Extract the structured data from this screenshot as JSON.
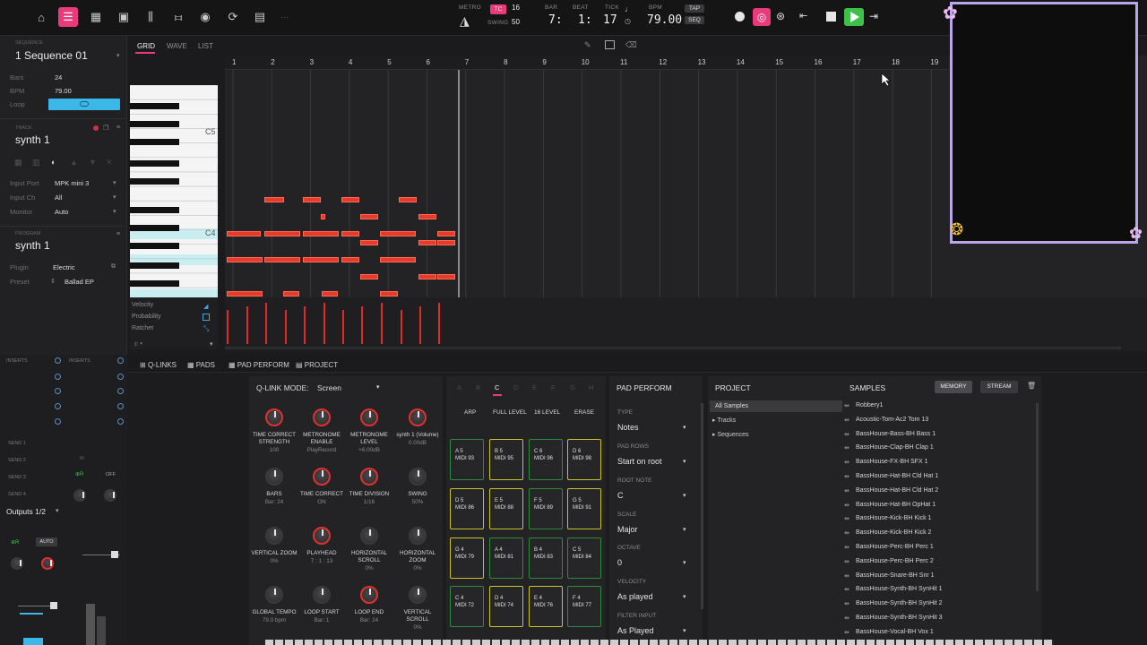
{
  "topbar": {
    "icons": [
      "home-icon",
      "piano-roll-icon",
      "grid-icon",
      "step-icon",
      "mixer-icon",
      "sliders-icon",
      "record-circle-icon",
      "loop-icon",
      "browser-icon"
    ],
    "metro_label": "METRO",
    "tc_label": "TC",
    "tc_value": "16",
    "swing_label": "SWING",
    "swing_value": "50",
    "bar_label": "BAR",
    "beat_label": "BEAT",
    "tick_label": "TICK",
    "bar_value": "7:",
    "beat_value": "1:",
    "tick_value": "17",
    "bpm_label": "BPM",
    "bpm_value": "79.00",
    "tap_label": "TAP",
    "seq_label": "SEQ"
  },
  "sequence": {
    "header": "SEQUENCE",
    "name": "1 Sequence 01",
    "bars_label": "Bars",
    "bars_value": "24",
    "bpm_label": "BPM",
    "bpm_value": "79.00",
    "loop_label": "Loop"
  },
  "track": {
    "header": "TRACK",
    "name": "synth 1",
    "input_port_label": "Input Port",
    "input_port_value": "MPK mini 3",
    "input_ch_label": "Input Ch",
    "input_ch_value": "All",
    "monitor_label": "Monitor",
    "monitor_value": "Auto"
  },
  "program": {
    "header": "PROGRAM",
    "name": "synth 1",
    "plugin_label": "Plugin",
    "plugin_value": "Electric",
    "preset_label": "Preset",
    "preset_value": "Ballad EP"
  },
  "view_tabs": [
    "GRID",
    "WAVE",
    "LIST"
  ],
  "piano_labels": {
    "c5": "C5",
    "c4": "C4"
  },
  "ruler_bars": [
    "1",
    "2",
    "3",
    "4",
    "5",
    "6",
    "7",
    "8",
    "9",
    "10",
    "11",
    "12",
    "13",
    "14",
    "15",
    "16",
    "17",
    "18",
    "19"
  ],
  "lanes": [
    "Velocity",
    "Probability",
    "Ratchet"
  ],
  "bottom_tabs": [
    "Q-LINKS",
    "PADS",
    "PAD PERFORM",
    "PROJECT"
  ],
  "qlink": {
    "mode_label": "Q-LINK MODE:",
    "mode_value": "Screen",
    "knobs": [
      {
        "label": "TIME CORRECT\nSTRENGTH",
        "value": "100"
      },
      {
        "label": "METRONOME\nENABLE",
        "value": "PlayRecord"
      },
      {
        "label": "METRONOME\nLEVEL",
        "value": "+6.00dB"
      },
      {
        "label": "synth 1 (Volume)",
        "value": "0.00dB"
      },
      {
        "label": "BARS",
        "value": "Bar: 24"
      },
      {
        "label": "TIME CORRECT",
        "value": "ON"
      },
      {
        "label": "TIME DIVISION",
        "value": "1/16"
      },
      {
        "label": "SWING",
        "value": "50%"
      },
      {
        "label": "VERTICAL ZOOM",
        "value": "0%"
      },
      {
        "label": "PLAYHEAD",
        "value": "7 : 1 : 13"
      },
      {
        "label": "HORIZONTAL\nSCROLL",
        "value": "0%"
      },
      {
        "label": "HORIZONTAL\nZOOM",
        "value": "0%"
      },
      {
        "label": "GLOBAL TEMPO",
        "value": "79.0 bpm"
      },
      {
        "label": "LOOP START",
        "value": "Bar: 1"
      },
      {
        "label": "LOOP END",
        "value": "Bar: 24"
      },
      {
        "label": "VERTICAL\nSCROLL",
        "value": "0%"
      }
    ]
  },
  "pads": {
    "banks": [
      "A",
      "B",
      "C",
      "D",
      "E",
      "F",
      "G",
      "H"
    ],
    "active_bank": "C",
    "buttons": [
      "ARP",
      "FULL LEVEL",
      "16 LEVEL",
      "ERASE"
    ],
    "grid": [
      {
        "name": "A 5\nMIDI 93",
        "y": false
      },
      {
        "name": "B 5\nMIDI 95",
        "y": true
      },
      {
        "name": "C 6\nMIDI 96",
        "y": false
      },
      {
        "name": "D 6\nMIDI 98",
        "y": true
      },
      {
        "name": "D 5\nMIDI 86",
        "y": true
      },
      {
        "name": "E 5\nMIDI 88",
        "y": true
      },
      {
        "name": "F 5\nMIDI 89",
        "y": false
      },
      {
        "name": "G 5\nMIDI 91",
        "y": true
      },
      {
        "name": "G 4\nMIDI 79",
        "y": true
      },
      {
        "name": "A 4\nMIDI 81",
        "y": false
      },
      {
        "name": "B 4\nMIDI 83",
        "y": false
      },
      {
        "name": "C 5\nMIDI 84",
        "y": false
      },
      {
        "name": "C 4\nMIDI 72",
        "y": false
      },
      {
        "name": "D 4\nMIDI 74",
        "y": true
      },
      {
        "name": "E 4\nMIDI 76",
        "y": true
      },
      {
        "name": "F 4\nMIDI 77",
        "y": false
      }
    ]
  },
  "pad_perform": {
    "title": "PAD PERFORM",
    "type_label": "TYPE",
    "type_value": "Notes",
    "rows_label": "PAD ROWS",
    "rows_value": "Start on root",
    "root_label": "ROOT NOTE",
    "root_value": "C",
    "scale_label": "SCALE",
    "scale_value": "Major",
    "octave_label": "OCTAVE",
    "octave_value": "0",
    "velocity_label": "VELOCITY",
    "velocity_value": "As played",
    "filter_label": "FILTER INPUT",
    "filter_value": "As Played"
  },
  "project": {
    "title": "PROJECT",
    "tree": [
      "All Samples",
      "Tracks",
      "Sequences"
    ]
  },
  "samples": {
    "title": "SAMPLES",
    "memory_btn": "MEMORY",
    "stream_btn": "STREAM",
    "items": [
      "Robbery1",
      "Acoustic-Tom-Ac2 Tom 13",
      "BassHouse-Bass-BH Bass 1",
      "BassHouse-Clap-BH Clap 1",
      "BassHouse-FX-BH SFX 1",
      "BassHouse-Hat-BH Cld Hat 1",
      "BassHouse-Hat-BH Cld Hat 2",
      "BassHouse-Hat-BH OpHat 1",
      "BassHouse-Kick-BH Kick 1",
      "BassHouse-Kick-BH Kick 2",
      "BassHouse-Perc-BH Perc 1",
      "BassHouse-Perc-BH Perc 2",
      "BassHouse-Snare-BH Snr 1",
      "BassHouse-Synth-BH SynHit 1",
      "BassHouse-Synth-BH SynHit 2",
      "BassHouse-Synth-BH SynHit 3",
      "BassHouse-Vocal-BH Vox 1"
    ]
  },
  "mixer": {
    "inserts_label": "INSERTS",
    "sends": [
      "SEND 1",
      "SEND 2",
      "SEND 3",
      "SEND 4"
    ],
    "outputs": "Outputs 1/2",
    "r_label": "R",
    "off_label": "OFF",
    "m_label": "M",
    "auto_label": "AUTO"
  },
  "colors": {
    "accent": "#e93a7c",
    "note": "#e63a2a",
    "loop": "#3bb7e8",
    "pad_green": "#2f8a3c",
    "pad_yellow": "#c9c22a"
  }
}
